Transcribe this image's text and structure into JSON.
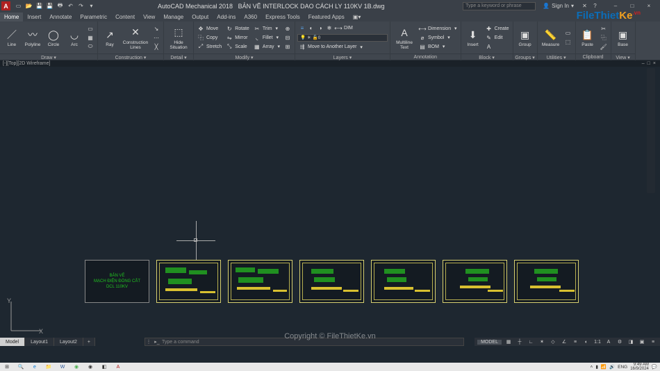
{
  "title": {
    "app": "AutoCAD Mechanical 2018",
    "file": "BẢN VẼ INTERLOCK DAO CÁCH LY 110KV 1B.dwg"
  },
  "search": {
    "placeholder": "Type a keyword or phrase"
  },
  "signin": {
    "label": "Sign In"
  },
  "ribbonTabs": [
    "Home",
    "Insert",
    "Annotate",
    "Parametric",
    "Content",
    "View",
    "Manage",
    "Output",
    "Add-ins",
    "A360",
    "Express Tools",
    "Featured Apps"
  ],
  "panels": {
    "draw": {
      "title": "Draw ▾",
      "line": "Line",
      "polyline": "Polyline",
      "circle": "Circle",
      "arc": "Arc"
    },
    "construction": {
      "title": "Construction ▾",
      "ray": "Ray",
      "lines": "Construction\nLines"
    },
    "detail": {
      "title": "Detail ▾",
      "hide": "Hide\nSituation"
    },
    "modify": {
      "title": "Modify ▾",
      "move": "Move",
      "rotate": "Rotate",
      "trim": "Trim",
      "copy": "Copy",
      "mirror": "Mirror",
      "fillet": "Fillet",
      "stretch": "Stretch",
      "scale": "Scale",
      "array": "Array",
      "dim": "DIM"
    },
    "layers": {
      "title": "Layers ▾",
      "current": "0",
      "moveTo": "Move to Another Layer"
    },
    "annotation": {
      "title": "Annotation",
      "multiline": "Multiline\nText",
      "dimension": "Dimension",
      "symbol": "Symbol",
      "bom": "BOM"
    },
    "block": {
      "title": "Block ▾",
      "insert": "Insert",
      "create": "Create",
      "edit": "Edit"
    },
    "groups": {
      "title": "Groups ▾",
      "group": "Group"
    },
    "utilities": {
      "title": "Utilities ▾",
      "measure": "Measure"
    },
    "clipboard": {
      "title": "Clipboard",
      "paste": "Paste"
    },
    "view": {
      "title": "View ▾",
      "base": "Base"
    }
  },
  "dwgHeader": {
    "left": "[-][Top][2D Wireframe]",
    "min": "–",
    "max": "□",
    "close": "×"
  },
  "coverSheet": {
    "l1": "BẢN VẼ",
    "l2": "MẠCH ĐIỆN ĐÓNG CẮT",
    "l3": "DCL 110KV"
  },
  "ucs": {
    "x": "X",
    "y": "Y"
  },
  "cmd": {
    "placeholder": "Type a command"
  },
  "layoutTabs": {
    "model": "Model",
    "l1": "Layout1",
    "l2": "Layout2",
    "plus": "+"
  },
  "watermark": {
    "center": "Copyright © FileThietKe.vn",
    "logo_a": "FileThiet",
    "logo_b": "Ke",
    "logo_c": ".vn"
  },
  "status": {
    "model": "MODEL",
    "scale": "1:1"
  },
  "taskbar": {
    "lang": "ENG",
    "time": "9:49 AM",
    "date": "16/9/2024",
    "tray_vol": "🔊",
    "tray_net": "📶"
  },
  "winBtns": {
    "min": "–",
    "max": "□",
    "close": "×"
  }
}
